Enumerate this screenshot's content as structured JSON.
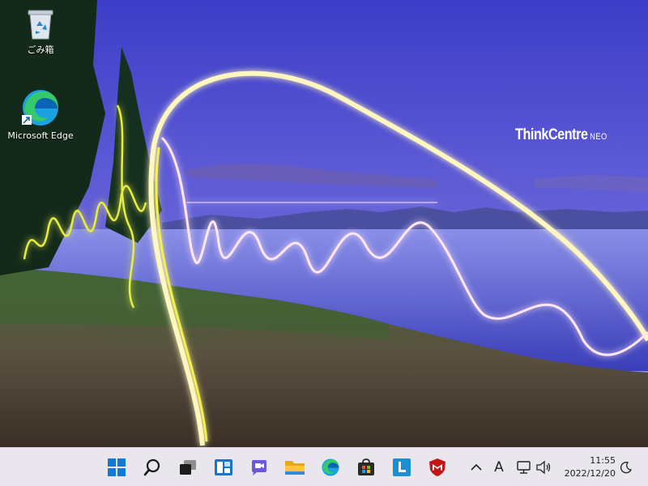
{
  "desktop": {
    "icons": [
      {
        "label": "ごみ箱",
        "icon": "recycle-bin-icon"
      },
      {
        "label": "Microsoft Edge",
        "icon": "edge-icon"
      }
    ],
    "brand": {
      "main": "ThinkCentre",
      "sub": "NEO"
    }
  },
  "taskbar": {
    "apps": [
      "start-icon",
      "search-icon",
      "task-view-icon",
      "widgets-icon",
      "chat-icon",
      "file-explorer-icon",
      "edge-icon",
      "store-icon",
      "lenovo-icon",
      "mcafee-icon"
    ],
    "tray": {
      "input_mode": "A",
      "time": "11:55",
      "date": "2022/12/20"
    }
  },
  "colors": {
    "taskbar_bg": "#e9e6ed",
    "windows_blue": "#0078d4",
    "mcafee_red": "#c01818",
    "light_trail": "#fff6c0"
  }
}
